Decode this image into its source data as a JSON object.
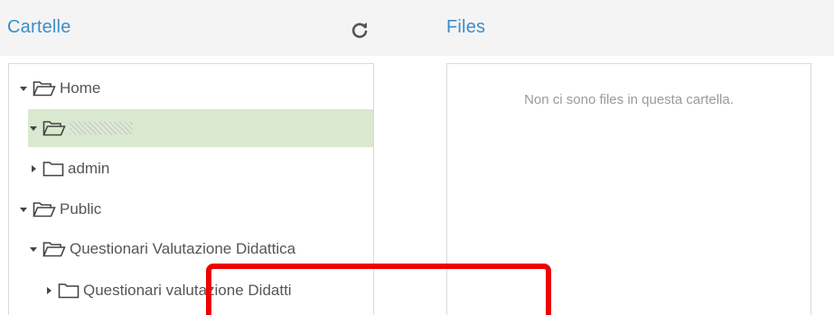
{
  "folders_panel": {
    "title": "Cartelle",
    "refresh_icon": "refresh-icon",
    "tree": [
      {
        "label": "Home",
        "expanded": true,
        "icon": "folder-open-icon"
      },
      {
        "label": "",
        "expanded": true,
        "selected": true,
        "icon": "folder-open-icon",
        "note": "name obscured"
      },
      {
        "label": "admin",
        "expanded": false,
        "icon": "folder-icon"
      },
      {
        "label": "Public",
        "expanded": true,
        "icon": "folder-open-icon"
      },
      {
        "label": "Questionari Valutazione Didattica",
        "expanded": true,
        "icon": "folder-open-icon"
      },
      {
        "label": "Questionari valutazione Didatti",
        "expanded": false,
        "icon": "folder-icon"
      }
    ]
  },
  "files_panel": {
    "title": "Files",
    "empty_message": "Non ci sono files in questa cartella."
  },
  "colors": {
    "title_blue": "#3a8ec7",
    "selected_row": "#d9e8cf",
    "highlight_red": "#ee0000"
  }
}
